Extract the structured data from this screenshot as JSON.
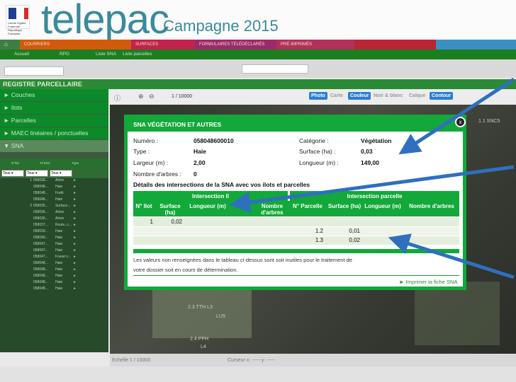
{
  "header": {
    "logo": "telepac",
    "campaign": "Campagne 2015",
    "flag_text": "Liberté Égalité Fraternité\nRépublique Française"
  },
  "nav": [
    "COURRIERS",
    "SURFACES",
    "FORMULAIRES TÉLÉDÉCLARÉS",
    "PRÉ-IMPRIMÉS"
  ],
  "subnav": [
    "Accueil",
    "RPG",
    "Liste SNA",
    "Liste parcelles"
  ],
  "page_title": "REGISTRE PARCELLAIRE",
  "left_menu": [
    "► Couches",
    "► Ilots",
    "► Parcelles",
    "► MAEC linéaires / ponctuelles",
    "▼ SNA"
  ],
  "grid": {
    "headers": [
      "N°Ilot",
      "N°SNA",
      "Type"
    ],
    "filters": [
      "Tous ▾",
      "Tous ▾",
      "Tous ▾"
    ],
    "rows": [
      [
        "1",
        "058038...",
        "Arbre"
      ],
      [
        "",
        "058048...",
        "Haie"
      ],
      [
        "",
        "058048...",
        "Forêt"
      ],
      [
        "",
        "058048...",
        "Haie"
      ],
      [
        "2",
        "058035...",
        "Surface..."
      ],
      [
        "",
        "058036...",
        "Arbre"
      ],
      [
        "",
        "058036...",
        "Arbre"
      ],
      [
        "",
        "058037...",
        "Route, c..."
      ],
      [
        "",
        "058039...",
        "Haie"
      ],
      [
        "",
        "058040...",
        "Haie"
      ],
      [
        "",
        "058047...",
        "Haie"
      ],
      [
        "",
        "058047...",
        "Haie"
      ],
      [
        "",
        "058047...",
        "Fossé n..."
      ],
      [
        "",
        "058048...",
        "Haie"
      ],
      [
        "",
        "058048...",
        "Haie"
      ],
      [
        "",
        "058048...",
        "Haie"
      ],
      [
        "",
        "058048...",
        "Haie"
      ],
      [
        "",
        "058048...",
        "Haie"
      ]
    ]
  },
  "toolbar": {
    "scale": "1 / 10000",
    "buttons": [
      "Photo",
      "Carte",
      "Couleur",
      "Noir & blanc",
      "Calque",
      "Contour"
    ]
  },
  "map_labels": [
    "2.3 TTH L3",
    "LU5",
    "2.4 PPH",
    "L4",
    "1.1 SNC5"
  ],
  "status": {
    "scale": "Echelle 1 / 10000",
    "cursor": "Curseur x: ----- y: -----"
  },
  "modal": {
    "title": "SNA VÉGÉTATION ET AUTRES",
    "close": "x",
    "fields": {
      "numero_label": "Numéro :",
      "numero": "058048600010",
      "categorie_label": "Catégorie :",
      "categorie": "Végétation",
      "type_label": "Type :",
      "type": "Haie",
      "surface_label": "Surface (ha) :",
      "surface": "0,03",
      "largeur_label": "Largeur (m) :",
      "largeur": "2,00",
      "longueur_label": "Longueur (m) :",
      "longueur": "149,00",
      "arbres_label": "Nombre d'arbres :",
      "arbres": "0"
    },
    "section": "Détails des intersections de la SNA avec vos ilots et parcelles",
    "table": {
      "group1": "Intersection îl",
      "group2": "Intersection parcelle",
      "cols": [
        "N° Ilot",
        "Surface (ha)",
        "Longueur (m)",
        "",
        "Nombre d'arbres",
        "N° Parcelle",
        "Surface (ha)",
        "Longueur (m)",
        "Nombre d'arbres"
      ],
      "rows": [
        {
          "ilot": "1",
          "surface": "0,02",
          "parcelle": "",
          "psurface": ""
        },
        {
          "ilot": "",
          "surface": "",
          "parcelle": "1.2",
          "psurface": "0,01"
        },
        {
          "ilot": "",
          "surface": "",
          "parcelle": "1.3",
          "psurface": "0,02"
        }
      ]
    },
    "note1": "Les valeurs non renseignées dans le tableau ci-dessus sont soit inutiles pour le traitement de",
    "note2": "votre dossier soit en cours de détermination.",
    "print": "► Imprimer la fiche SNA"
  },
  "colors": {
    "green": "#13a83a",
    "arrow": "#2f6fbf"
  }
}
